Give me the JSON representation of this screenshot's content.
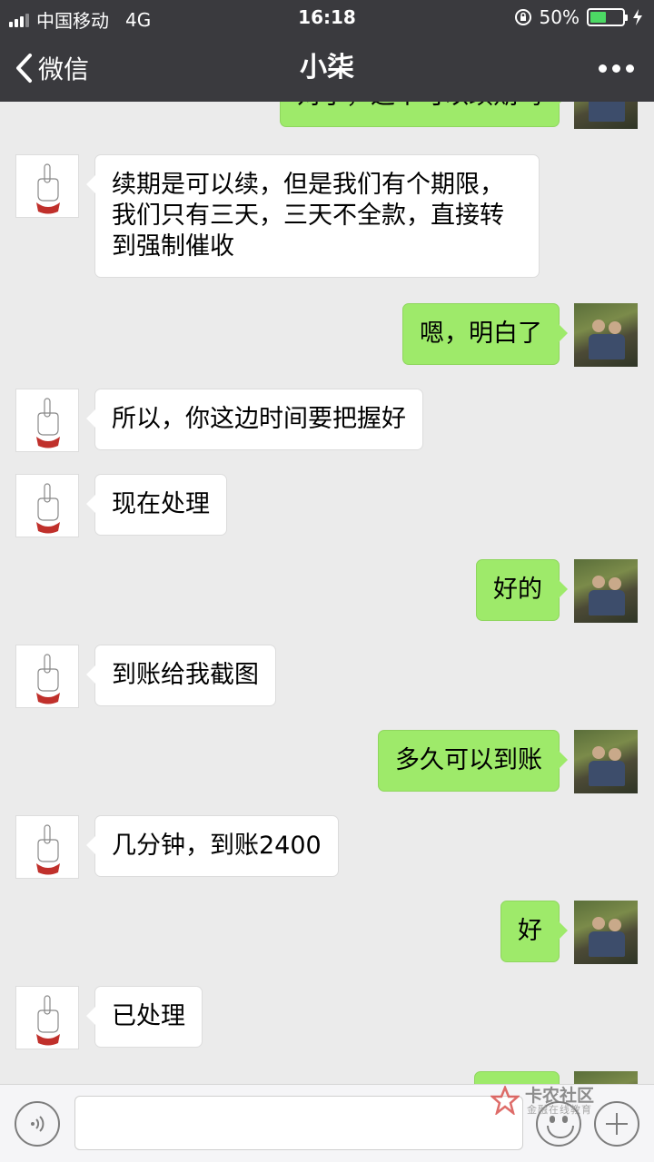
{
  "status_bar": {
    "carrier": "中国移动",
    "network": "4G",
    "time": "16:18",
    "battery": "50%",
    "battery_level": 0.5
  },
  "nav": {
    "back_label": "微信",
    "title": "小柒"
  },
  "messages": [
    {
      "side": "right",
      "text": "对了，这个可以续期吗"
    },
    {
      "side": "left",
      "text": "续期是可以续，但是我们有个期限，我们只有三天，三天不全款，直接转到强制催收"
    },
    {
      "side": "right",
      "text": "嗯，明白了"
    },
    {
      "side": "left",
      "text": "所以，你这边时间要把握好"
    },
    {
      "side": "left",
      "text": "现在处理"
    },
    {
      "side": "right",
      "text": "好的"
    },
    {
      "side": "left",
      "text": "到账给我截图"
    },
    {
      "side": "right",
      "text": "多久可以到账"
    },
    {
      "side": "left",
      "text": "几分钟，到账2400"
    },
    {
      "side": "right",
      "text": "好"
    },
    {
      "side": "left",
      "text": "已处理"
    }
  ],
  "watermark": {
    "title": "卡农社区",
    "subtitle": "金融在线教育"
  },
  "colors": {
    "bar": "#3a3a3e",
    "chat_bg": "#ebebeb",
    "sent_bubble": "#9eea6a",
    "received_bubble": "#ffffff",
    "battery": "#4cd964"
  }
}
